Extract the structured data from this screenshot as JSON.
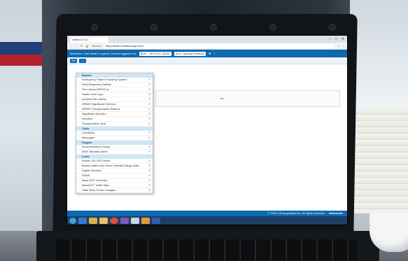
{
  "browser": {
    "tab_title": "WebEOC 8.2",
    "url_prefix": "Secure",
    "url": "https://fusion.webeocasp.com/",
    "window_controls": [
      "–",
      "□",
      "✕"
    ]
  },
  "app": {
    "welcome": "Welcome, Chris Smith | Logout | You are logged in as",
    "position": "BCR - OPS EOC DESK",
    "incident": "2017 January Incidents",
    "accent": "#0d69b0"
  },
  "menu": {
    "sections": [
      {
        "title": "Boards",
        "items": [
          "Emergency Patient Tracking System",
          "Field Requests (Hotlist)",
          "File Library (WEOC) ▸",
          "Health Unit Log ▸",
          "Incident File Library",
          "WRMS Significant Events ▸",
          "WRMS Transportation Status ▸",
          "Significant Events ▸",
          "Timeline",
          "Transportation Sub"
        ]
      },
      {
        "title": "Tools",
        "items": [
          "Checklists",
          "Messages"
        ]
      },
      {
        "title": "Plugins",
        "items": [
          "Documentation Library",
          "NWS Weather Alerts"
        ]
      },
      {
        "title": "Links",
        "items": [
          "Boston 311 GIS Online",
          "Boston Water and Sewer Rainfall Gauge Data",
          "Digital Sandbox",
          "FEMA",
          "Mass DOT Cameras",
          "MassDOT Traffic Map",
          "State Wide Power Outages"
        ]
      }
    ]
  },
  "content": {
    "text": "ies"
  },
  "footer": {
    "copyright": "© 2016 Ctb Acquisition Inc. All rights reserved.",
    "brand": "Intermedix"
  },
  "taskbar": {
    "apps": [
      "start",
      "ie",
      "explorer",
      "folder",
      "chrome",
      "paint",
      "files",
      "media",
      "word"
    ]
  }
}
